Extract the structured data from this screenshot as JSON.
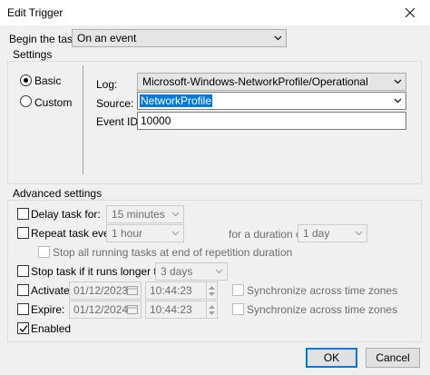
{
  "window": {
    "title": "Edit Trigger"
  },
  "begin": {
    "label": "Begin the task:",
    "value": "On an event"
  },
  "settings": {
    "group_label": "Settings",
    "basic_label": "Basic",
    "custom_label": "Custom",
    "log_label": "Log:",
    "log_value": "Microsoft-Windows-NetworkProfile/Operational",
    "source_label": "Source:",
    "source_value": "NetworkProfile",
    "event_id_label": "Event ID:",
    "event_id_value": "10000"
  },
  "advanced": {
    "group_label": "Advanced settings",
    "delay_label": "Delay task for:",
    "delay_value": "15 minutes",
    "repeat_label": "Repeat task every:",
    "repeat_value": "1 hour",
    "duration_label": "for a duration of:",
    "duration_value": "1 day",
    "stop_all_label": "Stop all running tasks at end of repetition duration",
    "stop_longer_label": "Stop task if it runs longer than:",
    "stop_longer_value": "3 days",
    "activate_label": "Activate:",
    "activate_date": "01/12/2023",
    "activate_time": "10:44:23",
    "expire_label": "Expire:",
    "expire_date": "01/12/2024",
    "expire_time": "10:44:23",
    "sync_label": "Synchronize across time zones",
    "enabled_label": "Enabled",
    "enabled_checked": true
  },
  "buttons": {
    "ok": "OK",
    "cancel": "Cancel"
  }
}
